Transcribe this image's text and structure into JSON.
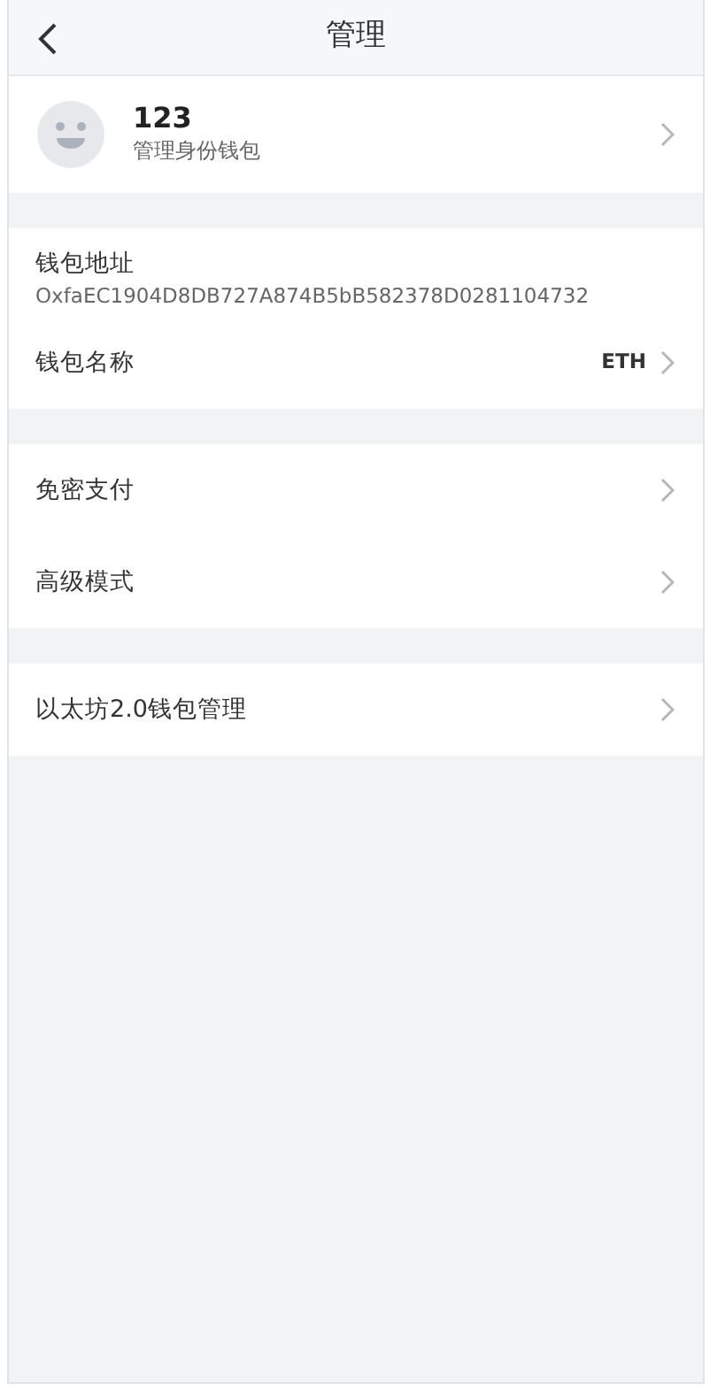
{
  "header": {
    "title": "管理"
  },
  "profile": {
    "name": "123",
    "subtitle": "管理身份钱包"
  },
  "groups": [
    {
      "rows": [
        {
          "kind": "address",
          "label": "钱包地址",
          "value": "OxfaEC1904D8DB727A874B5bB582378D0281104732"
        },
        {
          "kind": "link",
          "label": "钱包名称",
          "value": "ETH"
        }
      ]
    },
    {
      "rows": [
        {
          "kind": "link",
          "label": "免密支付"
        },
        {
          "kind": "link",
          "label": "高级模式"
        }
      ]
    },
    {
      "rows": [
        {
          "kind": "link",
          "label": "以太坊2.0钱包管理"
        }
      ]
    }
  ]
}
